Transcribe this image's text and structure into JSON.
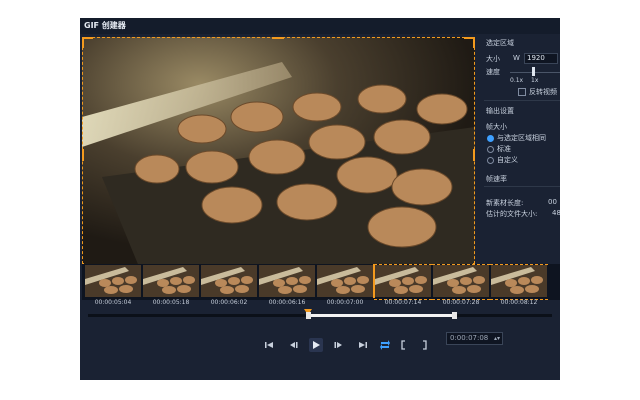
{
  "window": {
    "title": "GIF 创建器"
  },
  "panel": {
    "select_region": "选定区域",
    "size_label": "大小",
    "w_label": "W",
    "w_value": "1920",
    "speed_label": "速度",
    "speed_ticks": [
      "0.1x",
      "1x"
    ],
    "reverse_label": "反转视频",
    "output_settings": "输出设置",
    "frame_size": "帧大小",
    "frame_size_options": [
      "与选定区域相同",
      "标准",
      "自定义"
    ],
    "frame_size_selected": 0,
    "frame_rate": "帧速率",
    "new_length_label": "新素材长度:",
    "new_length_value": "00",
    "est_size_label": "估计的文件大小:",
    "est_size_value": "48"
  },
  "timeline": {
    "timestamps": [
      "00:00:05:04",
      "00:00:05:18",
      "00:00:06:02",
      "00:00:06:16",
      "00:00:07:00",
      "00:00:07:14",
      "00:00:07:28",
      "00:00:08:12"
    ]
  },
  "controls": {
    "timecode": "0:00:07:08"
  },
  "colors": {
    "accent": "#f39a1e",
    "window_bg": "#1a2233",
    "selected_radio": "#3ea0ff"
  }
}
